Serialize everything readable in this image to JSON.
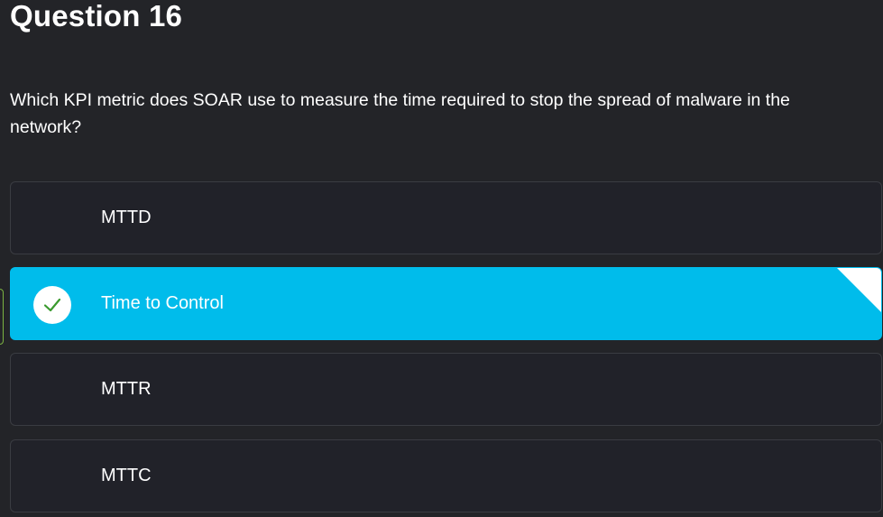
{
  "question": {
    "title": "Question 16",
    "text": "Which KPI metric does SOAR use to measure the time required to stop the spread of malware in the network?"
  },
  "options": [
    {
      "label": "MTTD",
      "selected": false
    },
    {
      "label": "Time to Control",
      "selected": true
    },
    {
      "label": "MTTR",
      "selected": false
    },
    {
      "label": "MTTC",
      "selected": false
    }
  ],
  "colors": {
    "background": "#232428",
    "option_background": "#212229",
    "selected_accent": "#00bceb",
    "check_mark": "#3a9a2e",
    "marker_border": "#7cb342"
  },
  "icons": {
    "selected_indicator": "checkmark-icon",
    "corner": "corner-fold-icon"
  }
}
